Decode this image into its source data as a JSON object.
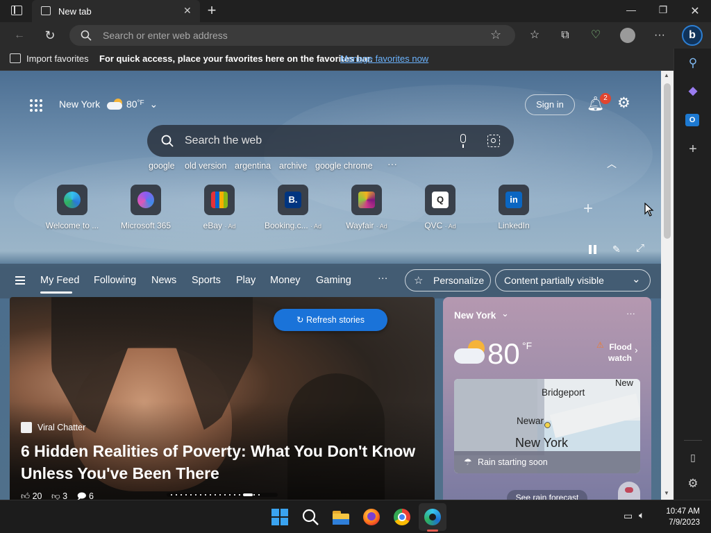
{
  "browser": {
    "tab_title": "New tab",
    "address_placeholder": "Search or enter web address",
    "favorites_bar": {
      "import_label": "Import favorites",
      "hint": "For quick access, place your favorites here on the favorites bar.",
      "manage_link": "Manage favorites now"
    }
  },
  "newtab": {
    "location": "New York",
    "temp": "80",
    "temp_unit": "°F",
    "sign_in": "Sign in",
    "notification_count": "2",
    "search_placeholder": "Search the web",
    "suggestions": [
      "google",
      "old version",
      "argentina",
      "archive",
      "google chrome"
    ],
    "quick_links": [
      {
        "label": "Welcome to ...",
        "ad": ""
      },
      {
        "label": "Microsoft 365",
        "ad": ""
      },
      {
        "label": "eBay",
        "ad": "· Ad"
      },
      {
        "label": "Booking.c...",
        "ad": "· Ad"
      },
      {
        "label": "Wayfair",
        "ad": "· Ad"
      },
      {
        "label": "QVC",
        "ad": "· Ad"
      },
      {
        "label": "LinkedIn",
        "ad": ""
      }
    ],
    "quick_link_glyphs": [
      "",
      "",
      "",
      "B.",
      "",
      "Q",
      "in"
    ]
  },
  "feed": {
    "tabs": [
      "My Feed",
      "Following",
      "News",
      "Sports",
      "Play",
      "Money",
      "Gaming"
    ],
    "personalize": "Personalize",
    "visibility": "Content partially visible",
    "refresh": "Refresh stories"
  },
  "hero": {
    "source": "Viral Chatter",
    "headline_line1": "6 Hidden Realities of Poverty: What You Don't Know",
    "headline_line2": "Unless You've Been There",
    "likes": "20",
    "dislikes": "3",
    "comments": "6"
  },
  "weather": {
    "location": "New York",
    "temp": "80",
    "unit": "°F",
    "alert_line1": "Flood",
    "alert_line2": "watch",
    "map_labels": {
      "new": "New",
      "bridgeport": "Bridgeport",
      "newark": "Newar",
      "nyc": "New York"
    },
    "rain_note": "Rain starting soon",
    "forecast_button": "See rain forecast"
  },
  "taskbar": {
    "time": "10:47 AM",
    "date": "7/9/2023"
  },
  "colors": {
    "accent": "#1a73d9",
    "link": "#6cb4ff",
    "badge": "#e0452f"
  }
}
